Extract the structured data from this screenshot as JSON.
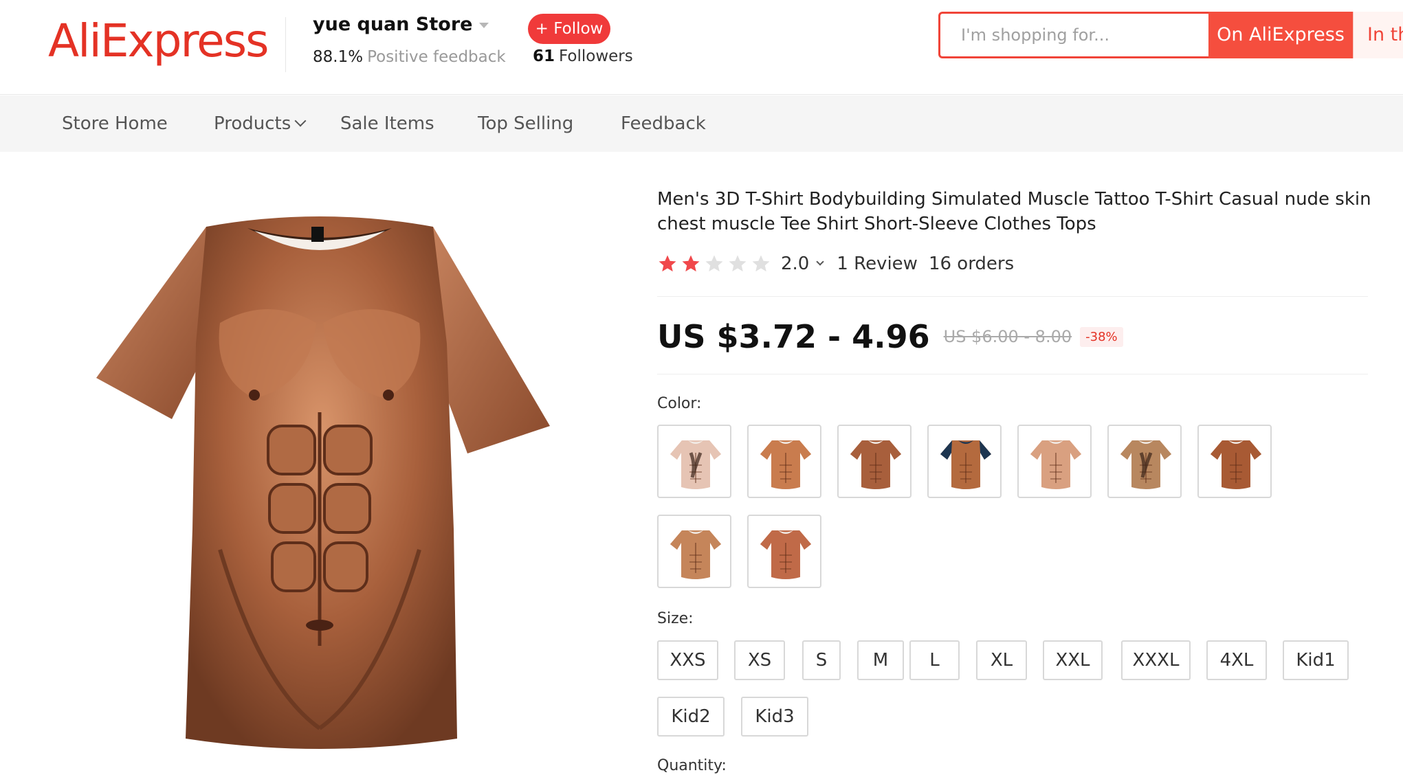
{
  "header": {
    "logo": "AliExpress",
    "store": {
      "name": "yue quan Store",
      "feedback_value": "88.1%",
      "feedback_label": "Positive feedback",
      "follow_label": "+ Follow",
      "followers_count": "61",
      "followers_label": "Followers"
    },
    "search": {
      "placeholder": "I'm shopping for...",
      "on_aliexpress_label": "On AliExpress",
      "in_store_label": "In th"
    }
  },
  "nav": {
    "items": [
      {
        "label": "Store Home"
      },
      {
        "label": "Products"
      },
      {
        "label": "Sale Items"
      },
      {
        "label": "Top Selling"
      },
      {
        "label": "Feedback"
      }
    ]
  },
  "product": {
    "title": "Men's 3D T-Shirt Bodybuilding Simulated Muscle Tattoo T-Shirt Casual nude skin chest muscle Tee Shirt Short-Sleeve Clothes Tops",
    "rating": {
      "stars_filled": 2,
      "stars_total": 5,
      "value": "2.0",
      "reviews": "1 Review",
      "orders": "16 orders"
    },
    "price": {
      "current": "US $3.72 - 4.96",
      "original": "US $6.00 - 8.00",
      "discount": "-38%"
    },
    "color": {
      "label": "Color:",
      "options": [
        {
          "name": "hairy-chest-pale",
          "color": "#e6c4b4",
          "hair": true
        },
        {
          "name": "tattoo-chest",
          "color": "#c97c4e",
          "hair": false
        },
        {
          "name": "abs-dark-collar",
          "color": "#a85f3c",
          "hair": false
        },
        {
          "name": "navy-collar-abs",
          "color": "#b46a3e",
          "collar": "#1d3550"
        },
        {
          "name": "light-abs",
          "color": "#d9a080",
          "hair": false
        },
        {
          "name": "hairy-torso",
          "color": "#b8875f",
          "hair": true
        },
        {
          "name": "deep-tan",
          "color": "#a85a34",
          "hair": false
        },
        {
          "name": "tan-abs",
          "color": "#c5855a",
          "hair": false
        },
        {
          "name": "red-tan",
          "color": "#c06a48",
          "hair": false
        }
      ]
    },
    "size": {
      "label": "Size:",
      "options": [
        "XXS",
        "XS",
        "S",
        "M",
        "L",
        "XL",
        "XXL",
        "XXXL",
        "4XL",
        "Kid1",
        "Kid2",
        "Kid3"
      ]
    },
    "quantity": {
      "label": "Quantity:"
    }
  },
  "colors": {
    "brand_red": "#e43225",
    "follow_red": "#f03a3a",
    "star_filled": "#f0484b",
    "star_empty": "#e0e0e0"
  }
}
